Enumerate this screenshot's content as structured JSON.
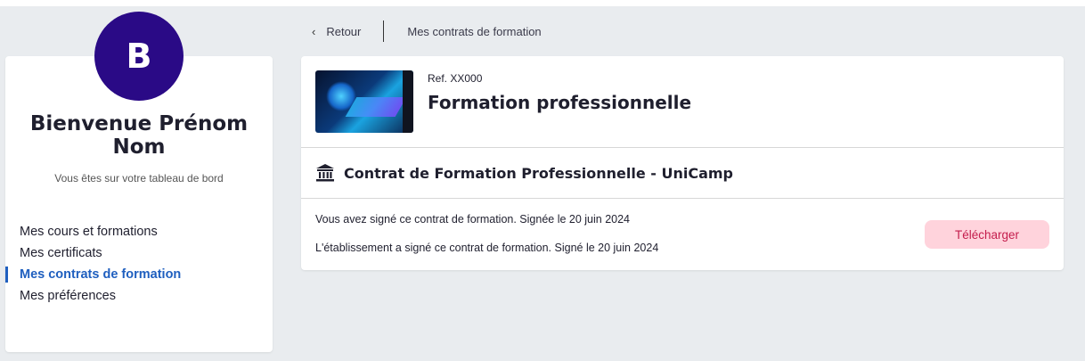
{
  "user": {
    "avatar_initial": "B",
    "welcome": "Bienvenue Prénom Nom",
    "subtitle": "Vous êtes sur votre tableau de bord"
  },
  "sidebar": {
    "items": [
      {
        "label": "Mes cours et formations",
        "active": false
      },
      {
        "label": "Mes certificats",
        "active": false
      },
      {
        "label": "Mes contrats de formation",
        "active": true
      },
      {
        "label": "Mes préférences",
        "active": false
      }
    ]
  },
  "breadcrumb": {
    "back_label": "Retour",
    "back_icon": "chevron-left-icon",
    "current": "Mes contrats de formation"
  },
  "course": {
    "ref": "Ref. XX000",
    "title": "Formation professionnelle"
  },
  "contract": {
    "icon": "bank-icon",
    "title": "Contrat de Formation Professionnelle - UniCamp",
    "signed_user": "Vous avez signé ce contrat de formation. Signée le 20 juin 2024",
    "signed_institution": "L'établissement a signé ce contrat de formation. Signé le 20 juin 2024",
    "download_label": "Télécharger"
  },
  "colors": {
    "avatar": "#2a0a86",
    "accent": "#1f5fbf",
    "button_bg": "#ffd3dc",
    "button_text": "#c41d4d"
  }
}
